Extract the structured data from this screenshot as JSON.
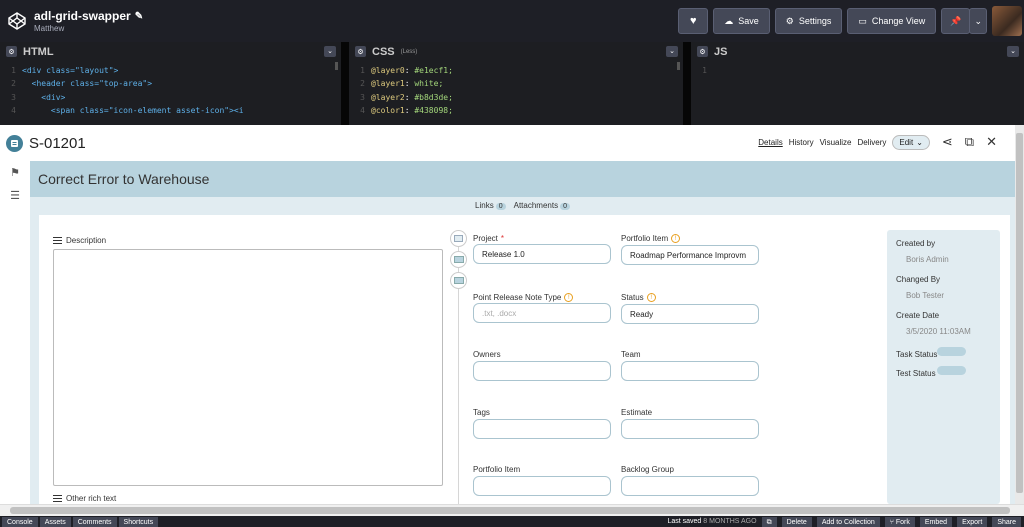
{
  "topbar": {
    "pen_title": "adl-grid-swapper",
    "author": "Matthew",
    "save_label": "Save",
    "settings_label": "Settings",
    "change_view_label": "Change View"
  },
  "editors": {
    "html": {
      "name": "HTML",
      "lines": [
        {
          "n": "1",
          "code": "<div class=\"layout\">"
        },
        {
          "n": "2",
          "code": "  <header class=\"top-area\">"
        },
        {
          "n": "3",
          "code": "    <div>"
        },
        {
          "n": "4",
          "code": "      <span class=\"icon-element asset-icon\"><i"
        }
      ]
    },
    "css": {
      "name": "CSS",
      "sub": "(Less)",
      "lines": [
        {
          "n": "1",
          "var": "@layer0",
          "val": "#e1ecf1;"
        },
        {
          "n": "2",
          "var": "@layer1",
          "val": "white;"
        },
        {
          "n": "3",
          "var": "@layer2",
          "val": "#b8d3de;"
        },
        {
          "n": "4",
          "var": "@color1",
          "val": "#438098;"
        }
      ]
    },
    "js": {
      "name": "JS",
      "lines": [
        {
          "n": "1",
          "code": ""
        }
      ]
    }
  },
  "app": {
    "asset_id": "S-01201",
    "tabs": [
      "Details",
      "History",
      "Visualize",
      "Delivery"
    ],
    "edit_label": "Edit",
    "title": "Correct Error to Warehouse",
    "links_label": "Links",
    "links_count": "0",
    "attachments_label": "Attachments",
    "attachments_count": "0",
    "description_label": "Description",
    "other_rich_text_label": "Other rich text",
    "fields": {
      "project_label": "Project",
      "project_required": "*",
      "project_value": "Release 1.0",
      "portfolio_item_label": "Portfolio Item",
      "portfolio_item_value": "Roadmap Performance Improvm",
      "point_release_label": "Point Release Note Type",
      "point_release_placeholder": ".txt, .docx",
      "status_label": "Status",
      "status_value": "Ready",
      "owners_label": "Owners",
      "team_label": "Team",
      "tags_label": "Tags",
      "estimate_label": "Estimate",
      "portfolio_item2_label": "Portfolio Item",
      "backlog_group_label": "Backlog Group",
      "info_glyph": "!"
    },
    "side": {
      "created_by_label": "Created by",
      "created_by_value": "Boris Admin",
      "changed_by_label": "Changed By",
      "changed_by_value": "Bob Tester",
      "create_date_label": "Create Date",
      "create_date_value": "3/5/2020 11:03AM",
      "task_status_label": "Task Status",
      "test_status_label": "Test Status"
    }
  },
  "bottombar": {
    "left": [
      "Console",
      "Assets",
      "Comments",
      "Shortcuts"
    ],
    "last_saved": "Last saved",
    "last_saved_when": "8 MONTHS AGO",
    "right": [
      "Delete",
      "Add to Collection",
      "Fork",
      "Embed",
      "Export",
      "Share"
    ]
  },
  "colors": {
    "layer0": "#e1ecf1",
    "layer1": "#ffffff",
    "layer2": "#b8d3de",
    "color1": "#438098"
  }
}
